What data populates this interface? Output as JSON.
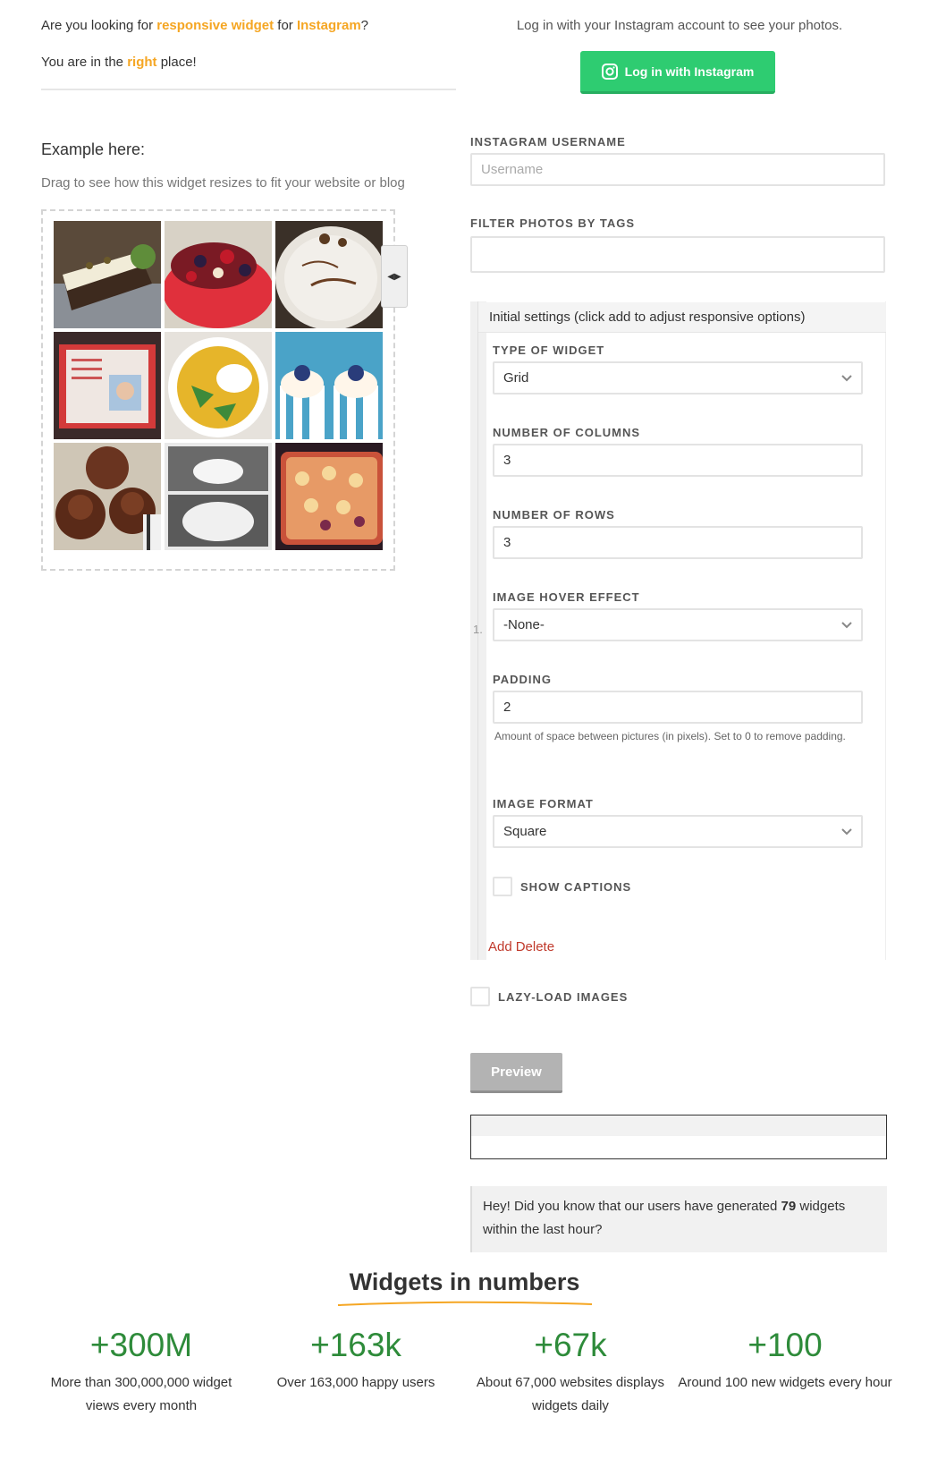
{
  "intro": {
    "line1_prefix": "Are you looking for ",
    "line1_highlight1": "responsive widget",
    "line1_mid": " for ",
    "line1_highlight2": "Instagram",
    "line1_suffix": "?",
    "line2_prefix": "You are in the ",
    "line2_highlight": "right",
    "line2_suffix": " place!"
  },
  "example": {
    "title": "Example here:",
    "subtitle": "Drag to see how this widget resizes to fit your website or blog",
    "photos": [
      {
        "icon": "cake-slice-photo"
      },
      {
        "icon": "berry-cake-photo"
      },
      {
        "icon": "decorated-cake-photo"
      },
      {
        "icon": "photo-cake-photo"
      },
      {
        "icon": "soup-bowl-photo"
      },
      {
        "icon": "cupcakes-photo"
      },
      {
        "icon": "chocolate-cupcakes-photo"
      },
      {
        "icon": "cake-collage-photo"
      },
      {
        "icon": "pie-photo"
      }
    ]
  },
  "login": {
    "note": "Log in with your Instagram account to see your photos.",
    "button_label": "Log in with Instagram",
    "button_color": "#2ecc71"
  },
  "form": {
    "username_label": "INSTAGRAM USERNAME",
    "username_placeholder": "Username",
    "tags_label": "FILTER PHOTOS BY TAGS",
    "tags_value": "",
    "settings_header": "Initial settings (click add to adjust responsive options)",
    "item_number": "1.",
    "type_label": "TYPE OF WIDGET",
    "type_value": "Grid",
    "columns_label": "NUMBER OF COLUMNS",
    "columns_value": "3",
    "rows_label": "NUMBER OF ROWS",
    "rows_value": "3",
    "hover_label": "IMAGE HOVER EFFECT",
    "hover_value": "-None-",
    "padding_label": "PADDING",
    "padding_value": "2",
    "padding_help": "Amount of space between pictures (in pixels). Set to 0 to remove padding.",
    "format_label": "IMAGE FORMAT",
    "format_value": "Square",
    "captions_label": "SHOW CAPTIONS",
    "add_label": "Add",
    "delete_label": "Delete",
    "lazy_label": "LAZY-LOAD IMAGES",
    "preview_label": "Preview"
  },
  "tip": {
    "prefix": "Hey! Did you know that our users have generated ",
    "count": "79",
    "suffix": " widgets within the last hour?"
  },
  "numbers": {
    "title": "Widgets in numbers",
    "accent_color": "#f5a623",
    "stats": [
      {
        "value": "+300M",
        "caption": "More than 300,000,000 widget views every month"
      },
      {
        "value": "+163k",
        "caption": "Over 163,000 happy users"
      },
      {
        "value": "+67k",
        "caption": "About 67,000 websites displays widgets daily"
      },
      {
        "value": "+100",
        "caption": "Around 100 new widgets every hour"
      }
    ]
  }
}
